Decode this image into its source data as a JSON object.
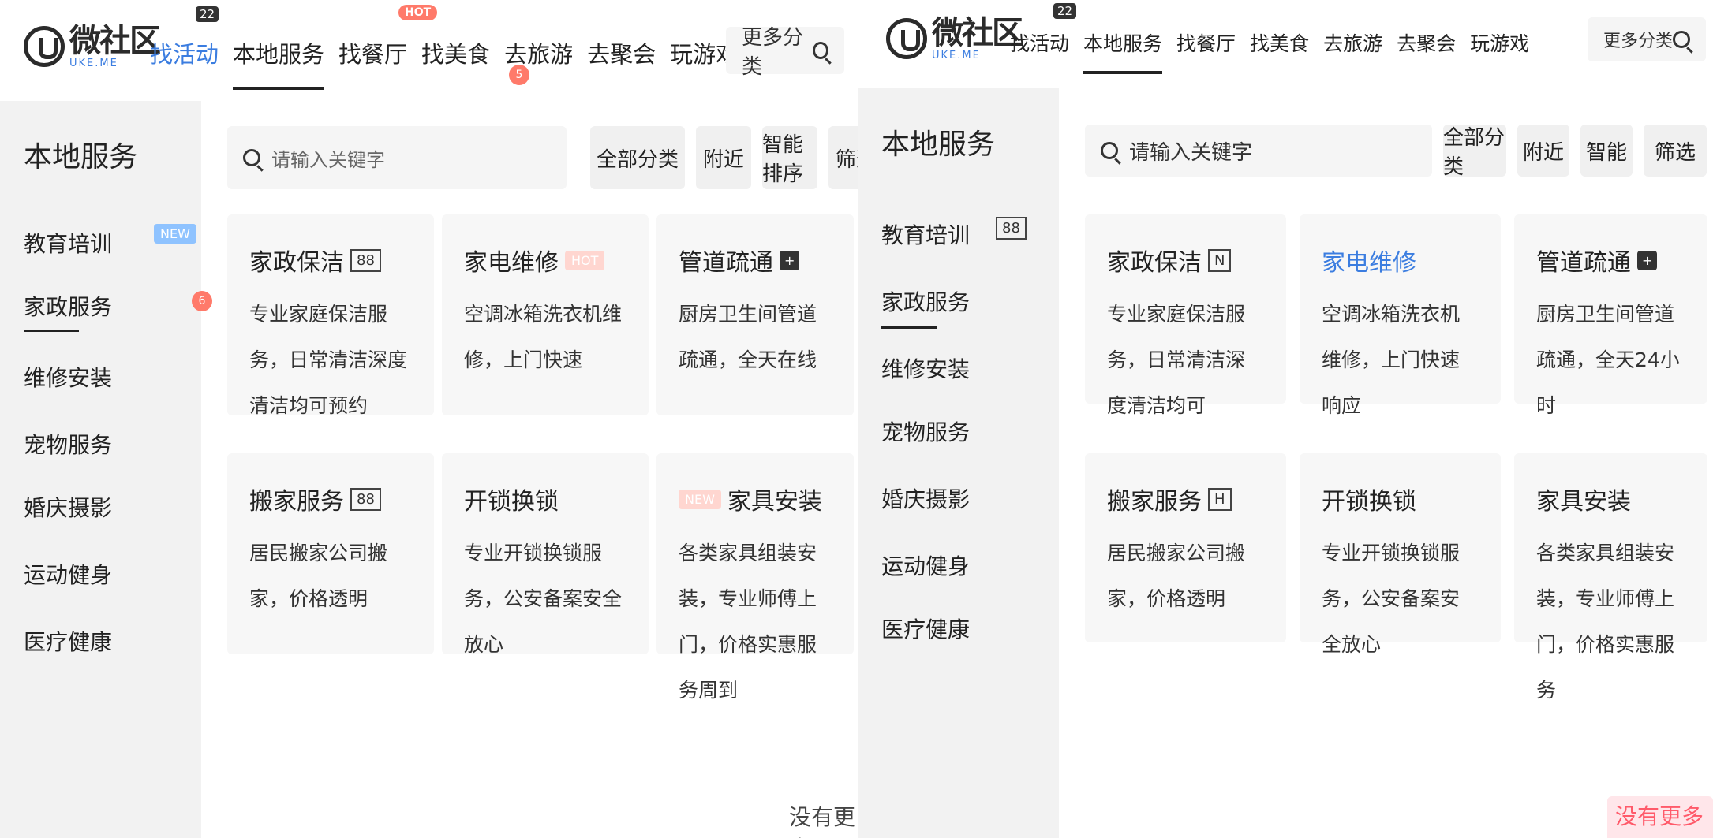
{
  "left": {
    "logo": {
      "main": "微社区",
      "sub": "UKE.ME"
    },
    "nav": {
      "items": [
        "找活动",
        "本地服务",
        "找餐厅",
        "找美食",
        "去旅游",
        "去聚会",
        "玩游戏"
      ],
      "badge_num": "22",
      "badge_hot": "HOT",
      "badge_dot": "5"
    },
    "top_search": {
      "label": "更多分类",
      "icon": "search-icon"
    },
    "sidebar": {
      "title": "本地服务",
      "items": [
        "教育培训",
        "家政服务",
        "维修安装",
        "宠物服务",
        "婚庆摄影",
        "运动健身",
        "医疗健康"
      ],
      "tag": "NEW",
      "dot": "6"
    },
    "search": {
      "placeholder": "请输入关键字"
    },
    "filters": [
      "全部分类",
      "附近",
      "智能排序",
      "筛选"
    ],
    "cards": [
      {
        "title": "家政保洁",
        "tag": "88",
        "desc": "专业家庭保洁服务，日常清洁深度清洁均可预约"
      },
      {
        "title": "家电维修",
        "tag": "HOT",
        "desc": "空调冰箱洗衣机维修，上门快速"
      },
      {
        "title": "管道疏通",
        "tag": "+",
        "desc": "厨房卫生间管道疏通，全天在线"
      },
      {
        "title": "搬家服务",
        "tag": "88",
        "desc": "居民搬家公司搬家，价格透明"
      },
      {
        "title": "开锁换锁",
        "tag": "",
        "desc": "专业开锁换锁服务，公安备案安全放心"
      },
      {
        "title": "家具安装",
        "tag": "NEW",
        "desc": "各类家具组装安装，专业师傅上门，价格实惠服务周到"
      }
    ],
    "corner": "没有更多了"
  },
  "right": {
    "logo": {
      "main": "微社区",
      "sub": "UKE.ME"
    },
    "nav": {
      "items": [
        "找活动",
        "本地服务",
        "找餐厅",
        "找美食",
        "去旅游",
        "去聚会",
        "玩游戏"
      ],
      "badge_num": "22"
    },
    "top_search": {
      "label": "更多分类",
      "icon": "search-icon"
    },
    "sidebar": {
      "title": "本地服务",
      "items": [
        "教育培训",
        "家政服务",
        "维修安装",
        "宠物服务",
        "婚庆摄影",
        "运动健身",
        "医疗健康"
      ],
      "tag": "88"
    },
    "search": {
      "placeholder": "请输入关键字"
    },
    "filters": [
      "全部分类",
      "附近",
      "智能",
      "筛选"
    ],
    "cards": [
      {
        "title": "家政保洁",
        "tag": "N",
        "desc": "专业家庭保洁服务，日常清洁深度清洁均可"
      },
      {
        "title": "家电维修",
        "tag": "",
        "desc": "空调冰箱洗衣机维修，上门快速响应"
      },
      {
        "title": "管道疏通",
        "tag": "+",
        "desc": "厨房卫生间管道疏通，全天24小时"
      },
      {
        "title": "搬家服务",
        "tag": "H",
        "desc": "居民搬家公司搬家，价格透明"
      },
      {
        "title": "开锁换锁",
        "tag": "",
        "desc": "专业开锁换锁服务，公安备案安全放心"
      },
      {
        "title": "家具安装",
        "tag": "",
        "desc": "各类家具组装安装，专业师傅上门，价格实惠服务"
      }
    ],
    "corner": "没有更多了"
  }
}
